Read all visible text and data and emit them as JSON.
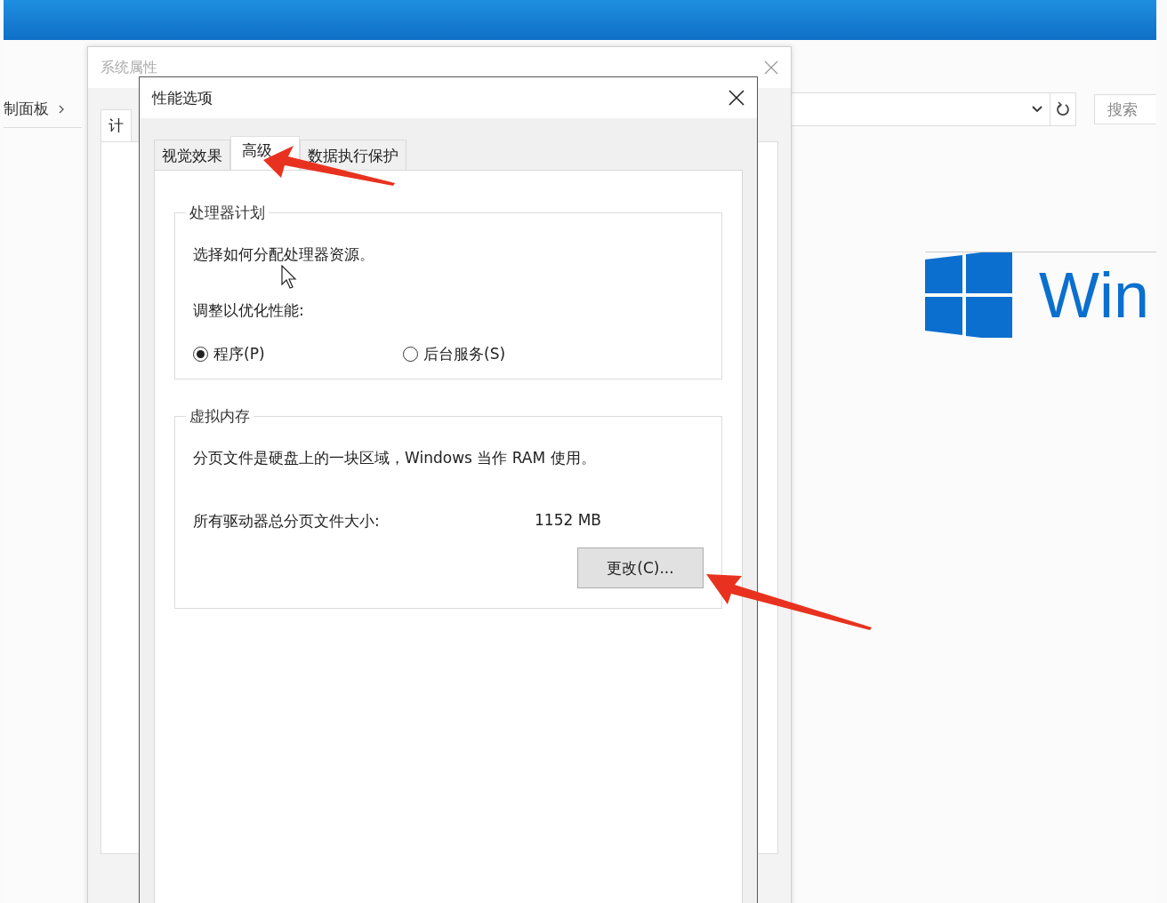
{
  "background_window": {
    "breadcrumb": "制面板",
    "search": {
      "placeholder": "搜索"
    },
    "brand": "Win"
  },
  "system_properties": {
    "title": "系统属性",
    "tab": "计"
  },
  "performance_options": {
    "title": "性能选项",
    "tabs": [
      {
        "label": "视觉效果",
        "selected": false
      },
      {
        "label": "高级",
        "selected": true
      },
      {
        "label": "数据执行保护",
        "selected": false
      }
    ],
    "processor_scheduling": {
      "title": "处理器计划",
      "description": "选择如何分配处理器资源。",
      "prompt": "调整以优化性能:",
      "options": [
        {
          "label": "程序(P)",
          "selected": true
        },
        {
          "label": "后台服务(S)",
          "selected": false
        }
      ]
    },
    "virtual_memory": {
      "title": "虚拟内存",
      "description": "分页文件是硬盘上的一块区域，Windows 当作 RAM 使用。",
      "size_label": "所有驱动器总分页文件大小:",
      "size_value": "1152 MB",
      "button": "更改(C)..."
    }
  }
}
